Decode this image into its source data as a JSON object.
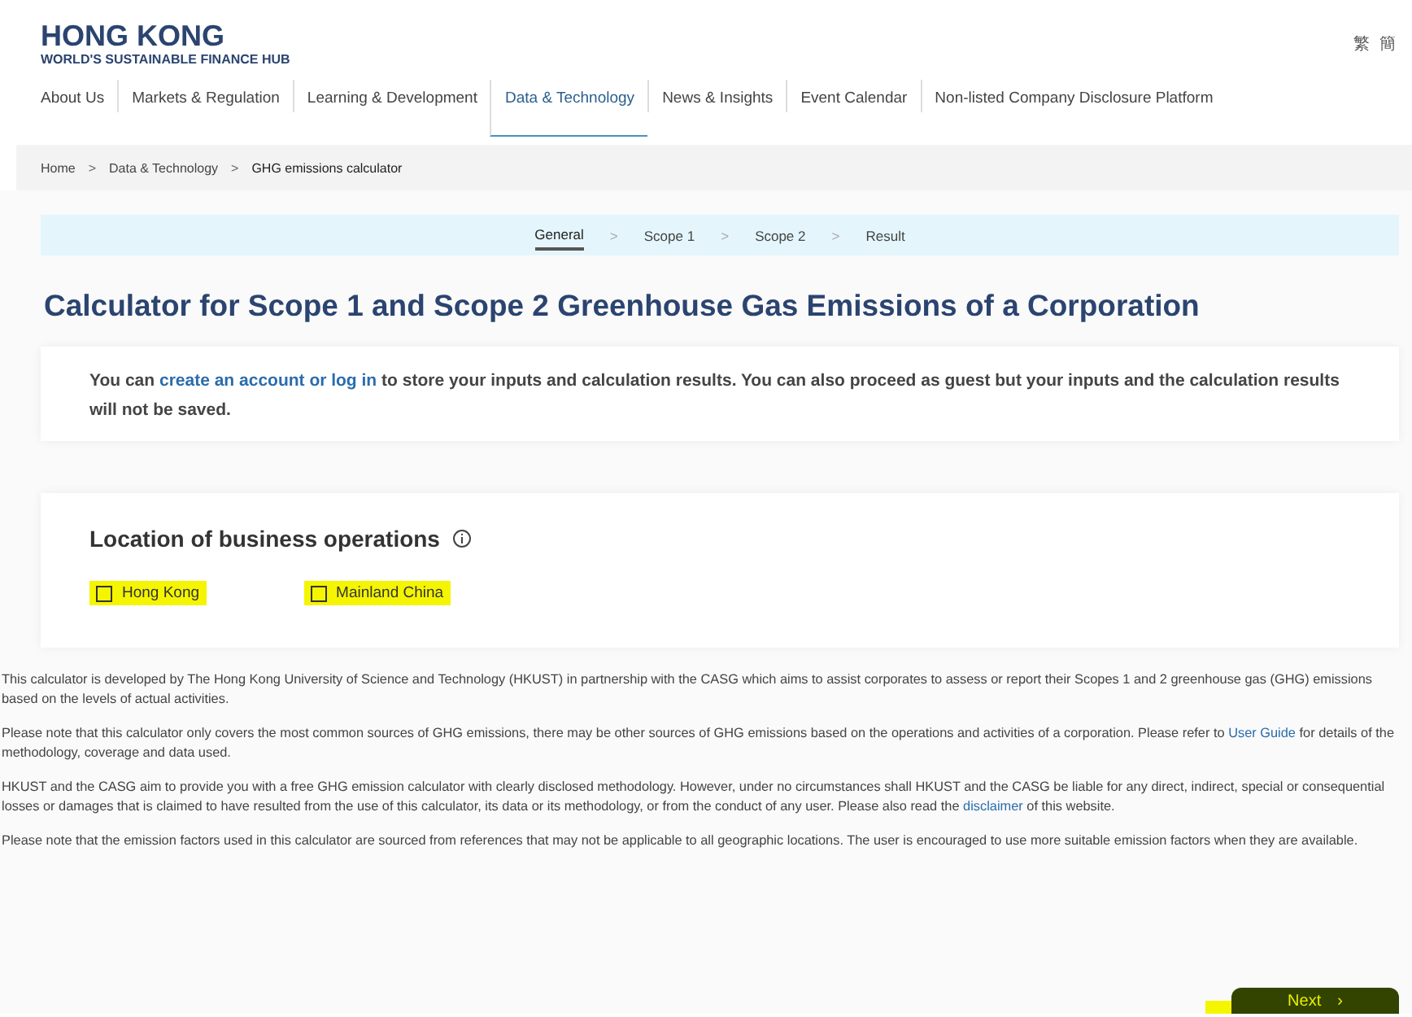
{
  "header": {
    "logo_title": "HONG KONG",
    "logo_subtitle": "WORLD'S SUSTAINABLE FINANCE HUB",
    "languages": [
      "繁",
      "簡"
    ]
  },
  "nav": [
    {
      "label": "About Us",
      "selected": false
    },
    {
      "label": "Markets & Regulation",
      "selected": false
    },
    {
      "label": "Learning & Development",
      "selected": false
    },
    {
      "label": "Data & Technology",
      "selected": true
    },
    {
      "label": "News & Insights",
      "selected": false
    },
    {
      "label": "Event Calendar",
      "selected": false
    },
    {
      "label": "Non-listed Company Disclosure Platform",
      "selected": false
    }
  ],
  "breadcrumb": [
    "Home",
    "Data & Technology",
    "GHG emissions calculator"
  ],
  "breadcrumb_separator": ">",
  "steps": [
    {
      "label": "General",
      "selected": true
    },
    {
      "label": "Scope 1",
      "selected": false
    },
    {
      "label": "Scope 2",
      "selected": false
    },
    {
      "label": "Result",
      "selected": false
    }
  ],
  "step_separator": ">",
  "title": "Calculator for Scope 1 and Scope 2 Greenhouse Gas Emissions of a Corporation",
  "notice": [
    {
      "kind": "text",
      "text": "You can "
    },
    {
      "kind": "link",
      "text": "create an account or log in"
    },
    {
      "kind": "text",
      "text": " to store your inputs and calculation results. You can also proceed as guest but your inputs and the calculation results will not be saved."
    }
  ],
  "location": {
    "heading": "Location of business operations",
    "options": [
      {
        "label": "Hong Kong",
        "checked": false,
        "highlighted": true
      },
      {
        "label": "Mainland China",
        "checked": false,
        "highlighted": true
      }
    ]
  },
  "paragraphs": [
    [
      {
        "kind": "text",
        "text": "This calculator is developed by The Hong Kong University of Science and Technology (HKUST) in partnership with the CASG which aims to assist corporates to assess or report their Scopes 1 and 2 greenhouse gas (GHG) emissions based on the levels of actual activities."
      }
    ],
    [
      {
        "kind": "text",
        "text": "Please note that this calculator only covers the most common sources of GHG emissions, there may be other sources of GHG emissions based on the operations and activities of a corporation. Please refer to "
      },
      {
        "kind": "link",
        "text": "User Guide"
      },
      {
        "kind": "text",
        "text": " for details of the methodology, coverage and data used."
      }
    ],
    [
      {
        "kind": "text",
        "text": "HKUST and the CASG aim to provide you with a free GHG emission calculator with clearly disclosed methodology. However, under no circumstances shall HKUST and the CASG be liable for any direct, indirect, special or consequential losses or damages that is claimed to have resulted from the use of this calculator, its data or its methodology, or from the conduct of any user. Please also read the "
      },
      {
        "kind": "link",
        "text": "disclaimer"
      },
      {
        "kind": "text",
        "text": " of this website."
      }
    ],
    [
      {
        "kind": "text",
        "text": "Please note that the emission factors used in this calculator are sourced from references that may not be applicable to all geographic locations. The user is encouraged to use more suitable emission factors when they are available."
      }
    ]
  ],
  "next_button": {
    "label": "Next",
    "icon": "›",
    "highlighted": true
  }
}
